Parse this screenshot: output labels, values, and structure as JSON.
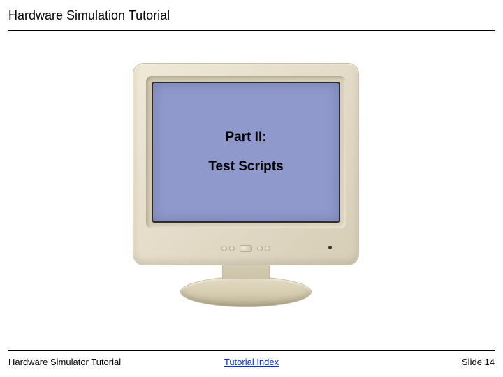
{
  "header": {
    "title": "Hardware Simulation Tutorial"
  },
  "screen": {
    "part": "Part II:",
    "subtitle": "Test Scripts"
  },
  "footer": {
    "left": "Hardware Simulator Tutorial",
    "link": "Tutorial Index",
    "right": "Slide 14"
  }
}
